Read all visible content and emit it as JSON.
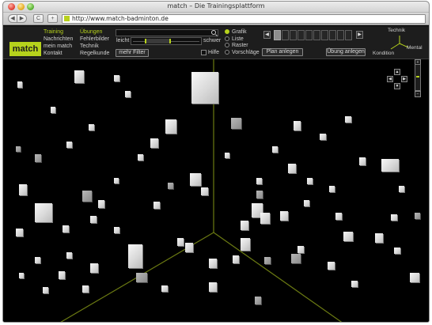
{
  "window": {
    "title": "match – Die Trainingsplattform"
  },
  "browser": {
    "back_label": "◀",
    "forward_label": "▶",
    "reload_label": "C",
    "add_label": "+",
    "url": "http://www.match-badminton.de"
  },
  "app": {
    "logo": "match",
    "accent_color": "#b6d21c",
    "nav_col1": [
      {
        "label": "Training",
        "active": true
      },
      {
        "label": "Nachrichten"
      },
      {
        "label": "mein match"
      },
      {
        "label": "Kontakt"
      }
    ],
    "nav_col2": [
      {
        "label": "Übungen",
        "active": true
      },
      {
        "label": "Fehlerbilder"
      },
      {
        "label": "Technik"
      },
      {
        "label": "Regelkunde"
      }
    ],
    "search": {
      "placeholder": ""
    },
    "difficulty": {
      "min_label": "leicht",
      "max_label": "schwer",
      "range_from": 0.18,
      "range_to": 0.55
    },
    "filter_button": "mehr Filter",
    "help_label": "Hilfe",
    "view_options": [
      {
        "label": "Grafik",
        "checked": true
      },
      {
        "label": "Liste"
      },
      {
        "label": "Raster"
      },
      {
        "label": "Vorschläge"
      }
    ],
    "plan_button": "Plan anlegen",
    "exercise_button": "Übung anlegen",
    "plan_arrow_left": "◀",
    "plan_arrow_right": "▶",
    "plan_slots_total": 10,
    "plan_slots_filled": 1,
    "triad": {
      "top": "Technik",
      "left": "Kondition",
      "right": "Mental"
    }
  },
  "view_controls": {
    "up": "▲",
    "down": "▼",
    "left": "◀",
    "right": "▶",
    "zoom_in": "+",
    "zoom_out": "−",
    "zoom_level": 0.45
  }
}
